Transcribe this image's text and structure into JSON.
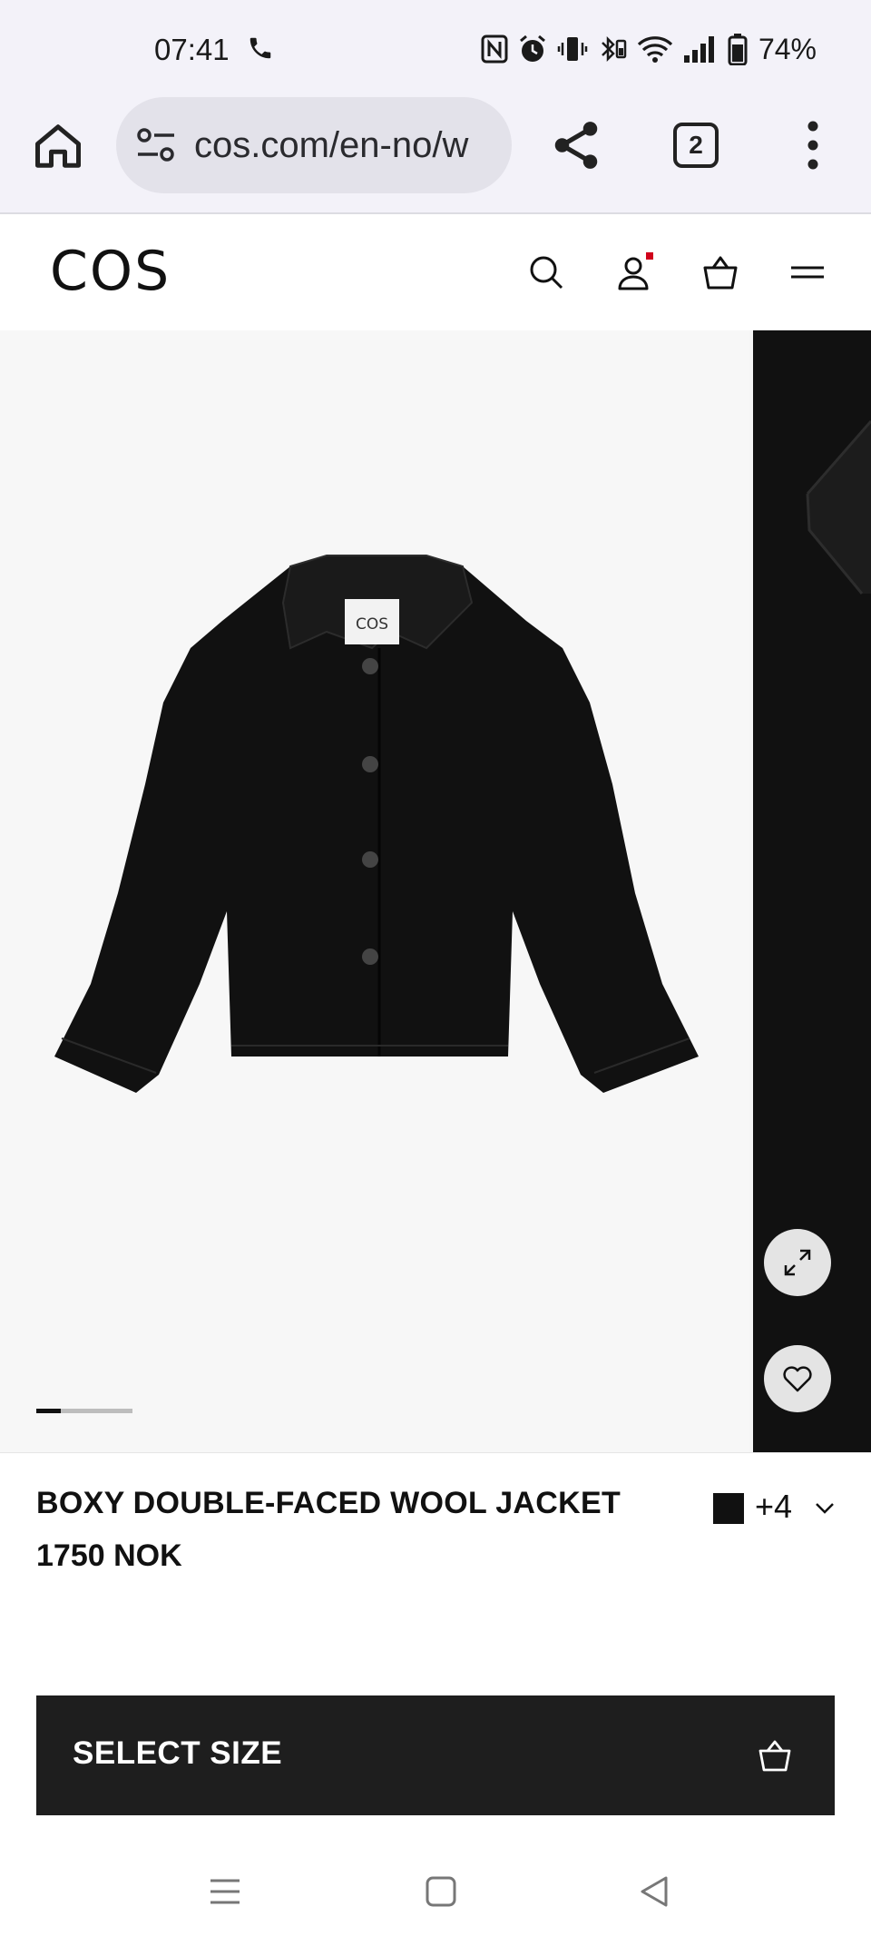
{
  "status_bar": {
    "time": "07:41",
    "battery": "74%"
  },
  "browser": {
    "url": "cos.com/en-no/w",
    "tab_count": "2"
  },
  "site": {
    "logo": "COS"
  },
  "gallery": {
    "main_image_label": "COS",
    "current_slide": 1,
    "progress_fraction": 0.25
  },
  "product": {
    "name": "BOXY DOUBLE-FACED WOOL JACKET",
    "price": "1750 NOK",
    "selected_color": "#111111",
    "more_colors": "+4"
  },
  "actions": {
    "select_size": "SELECT SIZE"
  },
  "colors": {
    "status_bg": "#f3f2f9",
    "url_pill_bg": "#e3e2ea",
    "button_dark": "#1e1e1e",
    "accent_dot": "#d0021b"
  }
}
